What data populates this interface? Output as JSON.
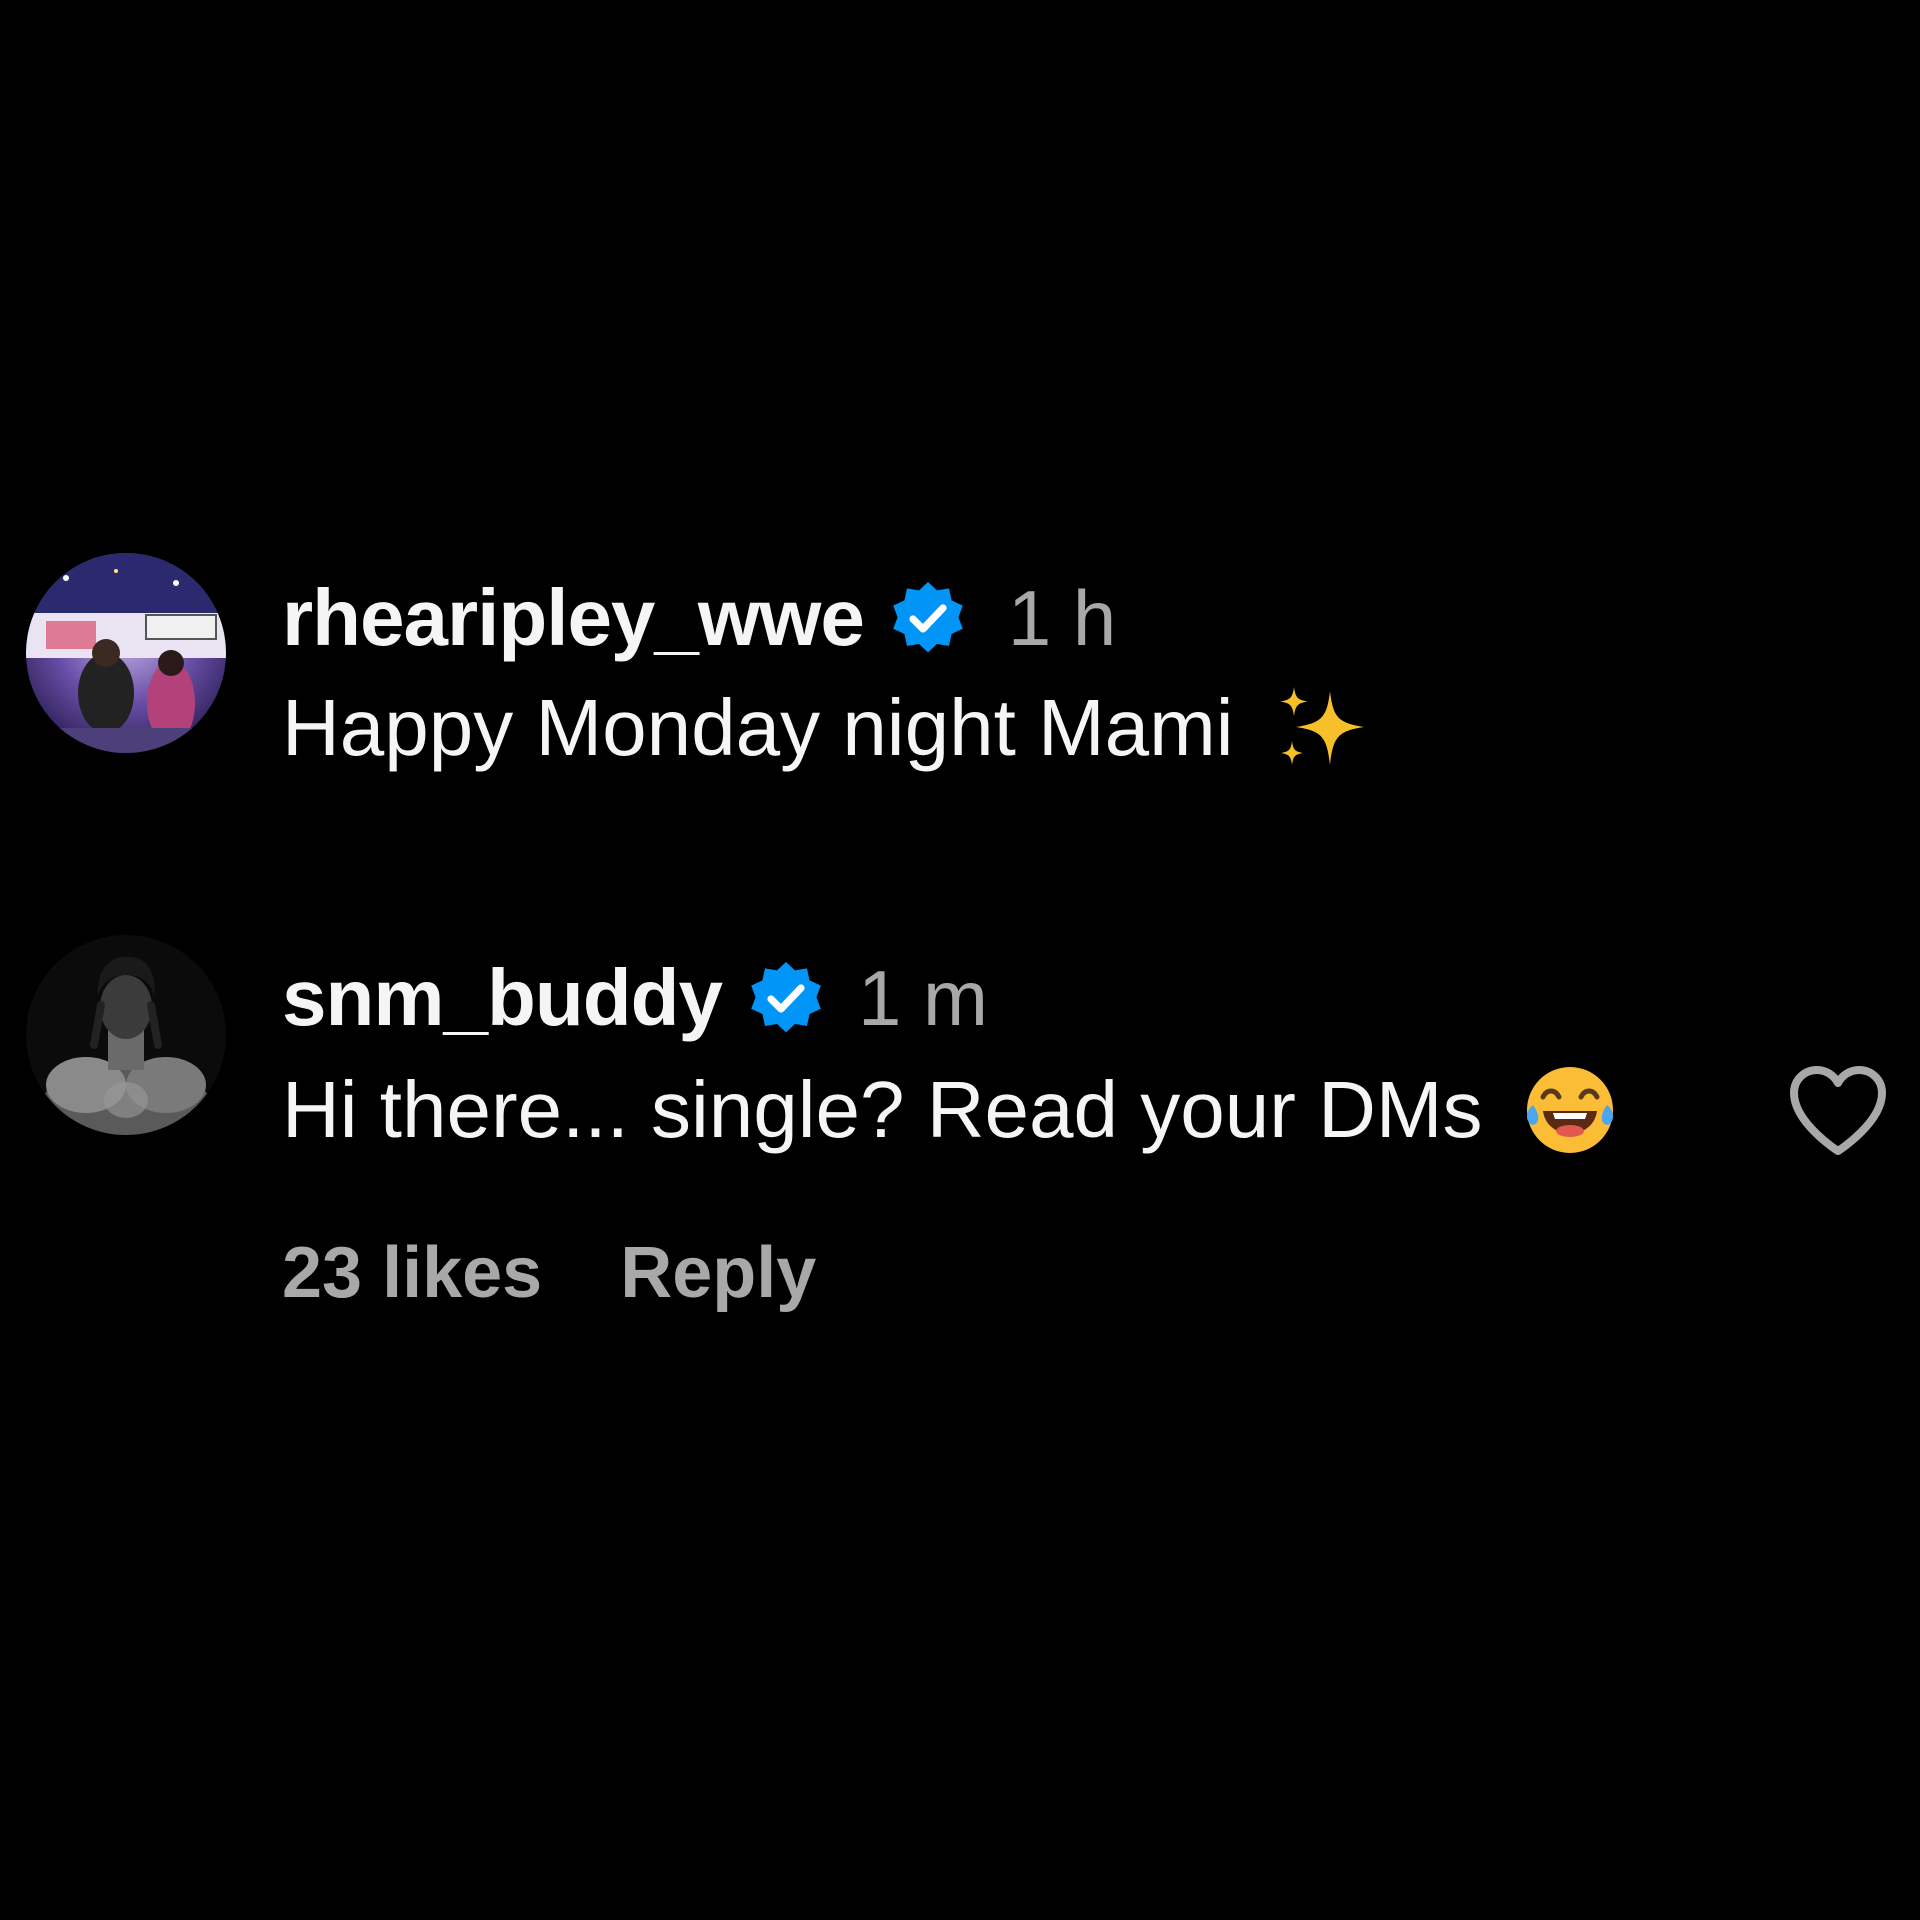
{
  "comments": [
    {
      "username": "rhearipley_wwe",
      "verified": true,
      "timestamp": "1 h",
      "text": "Happy Monday night Mami",
      "emoji": "sparkles-emoji"
    },
    {
      "username": "snm_buddy",
      "verified": true,
      "timestamp": "1 m",
      "text": "Hi there... single? Read your DMs",
      "emoji": "face-with-tears-of-joy-emoji",
      "likes_label": "23 likes",
      "reply_label": "Reply",
      "like_icon": "heart-outline-icon"
    }
  ],
  "colors": {
    "background": "#000000",
    "primary_text": "#f5f5f5",
    "secondary_text": "#a8a8a8",
    "verified_blue": "#0095f6"
  }
}
